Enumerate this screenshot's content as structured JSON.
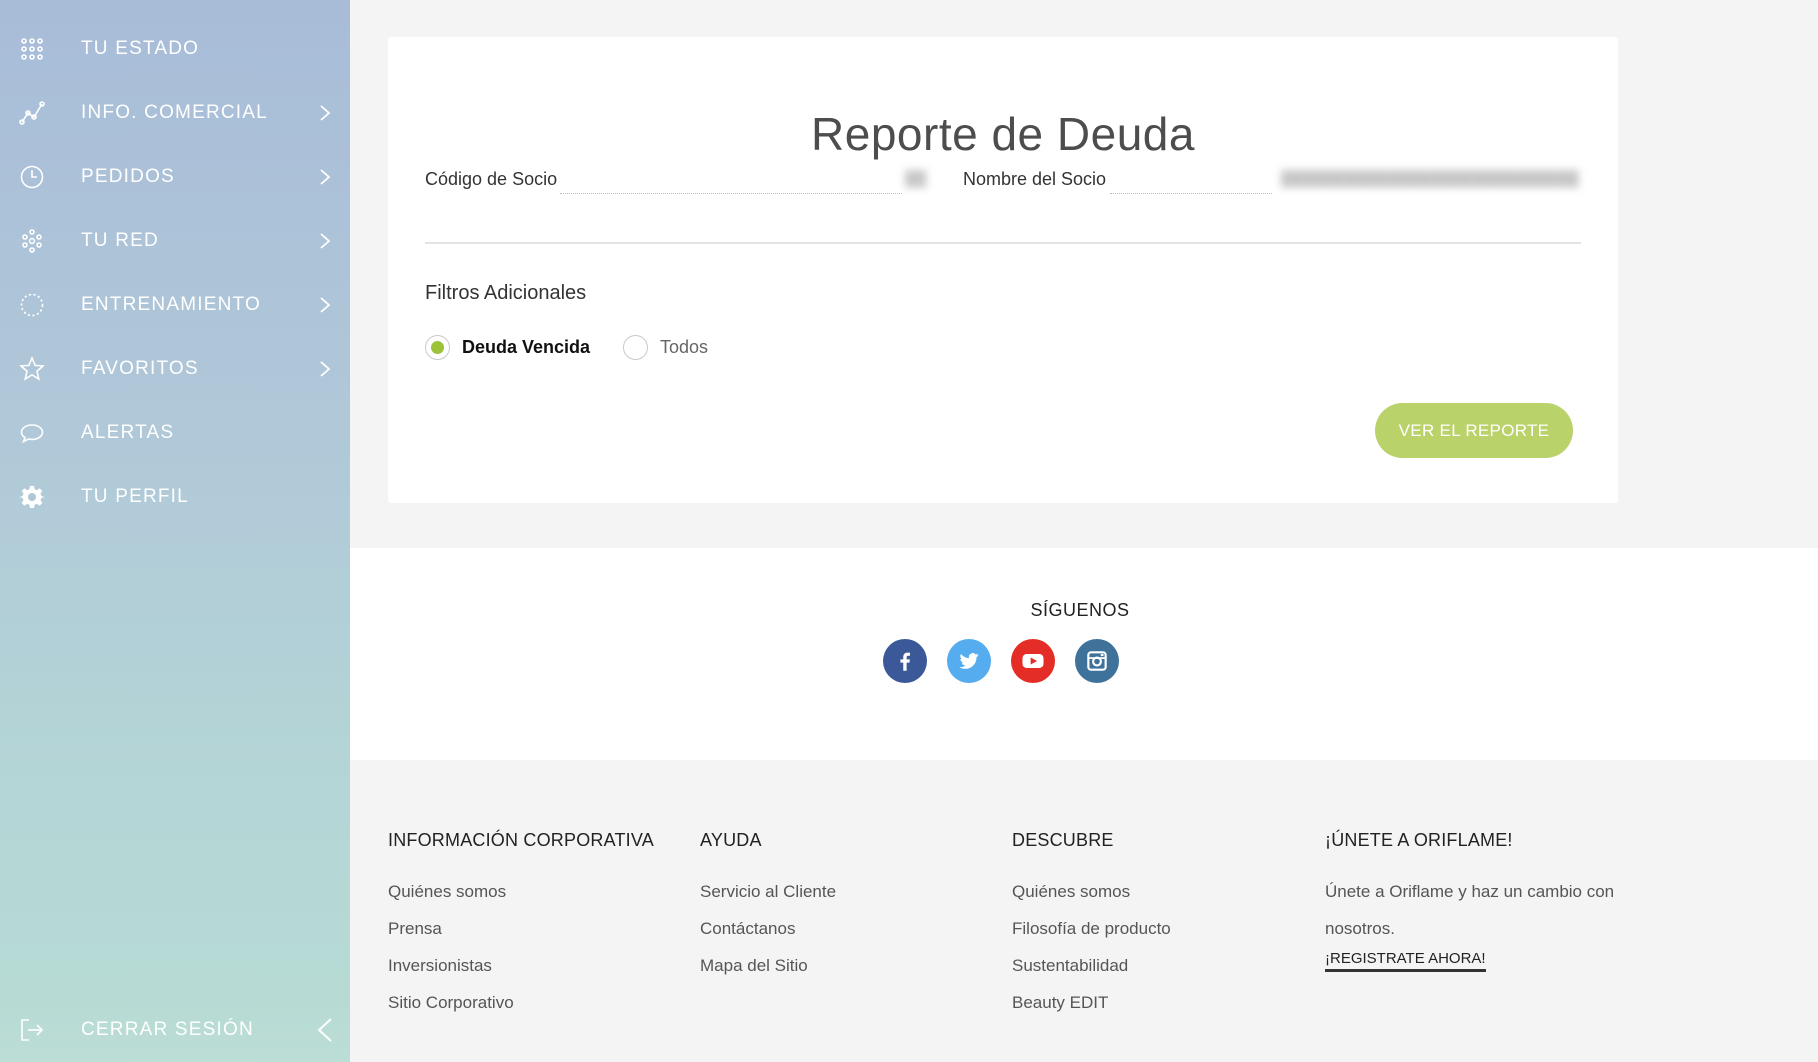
{
  "sidebar": {
    "items": [
      {
        "label": "TU ESTADO",
        "icon": "grid-dots-icon",
        "has_chevron": false
      },
      {
        "label": "INFO. COMERCIAL",
        "icon": "line-chart-icon",
        "has_chevron": true
      },
      {
        "label": "PEDIDOS",
        "icon": "clock-icon",
        "has_chevron": true
      },
      {
        "label": "TU RED",
        "icon": "network-icon",
        "has_chevron": true
      },
      {
        "label": "ENTRENAMIENTO",
        "icon": "dotted-circle-icon",
        "has_chevron": true
      },
      {
        "label": "FAVORITOS",
        "icon": "star-icon",
        "has_chevron": true
      },
      {
        "label": "ALERTAS",
        "icon": "speech-bubble-icon",
        "has_chevron": false
      },
      {
        "label": "TU PERFIL",
        "icon": "gear-icon",
        "has_chevron": false
      }
    ],
    "logout_label": "CERRAR SESIÓN"
  },
  "report": {
    "title": "Reporte de Deuda",
    "partner_code_label": "Código de Socio",
    "partner_name_label": "Nombre del Socio",
    "filters_title": "Filtros Adicionales",
    "filter_options": [
      {
        "label": "Deuda Vencida",
        "checked": true
      },
      {
        "label": "Todos",
        "checked": false
      }
    ],
    "submit_label": "VER EL REPORTE"
  },
  "social": {
    "title": "SÍGUENOS",
    "networks": [
      {
        "name": "facebook-icon",
        "color": "#3b5998"
      },
      {
        "name": "twitter-icon",
        "color": "#55acee"
      },
      {
        "name": "youtube-icon",
        "color": "#e52d27"
      },
      {
        "name": "instagram-icon",
        "color": "#3f729b"
      }
    ]
  },
  "footer": {
    "corporate": {
      "heading": "INFORMACIÓN CORPORATIVA",
      "links": [
        "Quiénes somos",
        "Prensa",
        "Inversionistas",
        "Sitio Corporativo"
      ]
    },
    "help": {
      "heading": "AYUDA",
      "links": [
        "Servicio al Cliente",
        "Contáctanos",
        "Mapa del Sitio"
      ]
    },
    "discover": {
      "heading": "DESCUBRE",
      "links": [
        "Quiénes somos",
        "Filosofía de producto",
        "Sustentabilidad",
        "Beauty EDIT"
      ]
    },
    "join": {
      "heading": "¡ÚNETE A ORIFLAME!",
      "text": "Únete a Oriflame y haz un cambio con nosotros.",
      "cta": "¡REGISTRATE AHORA!"
    }
  },
  "colors": {
    "accent_green": "#9cc23a",
    "button_green": "#bad26a"
  }
}
